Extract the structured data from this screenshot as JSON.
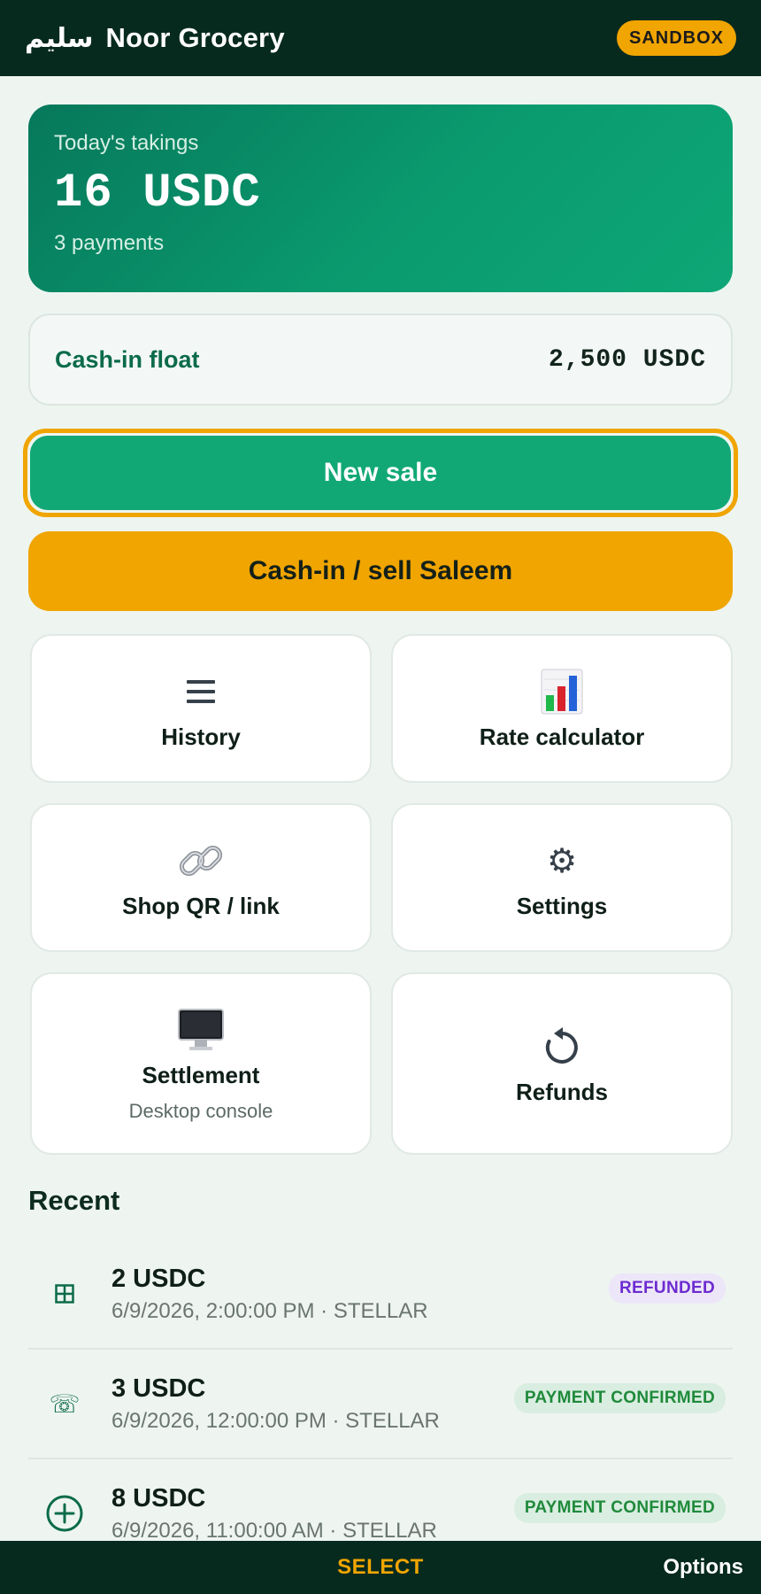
{
  "header": {
    "brand_arabic": "سليم",
    "brand_name": "Noor Grocery",
    "badge": "SANDBOX"
  },
  "takings": {
    "label": "Today's takings",
    "amount": "16 USDC",
    "count": "3 payments"
  },
  "float": {
    "label": "Cash-in float",
    "value": "2,500 USDC"
  },
  "actions": {
    "new_sale": "New sale",
    "cash_in": "Cash-in / sell Saleem"
  },
  "tiles": [
    {
      "label": "History",
      "icon": "list-icon"
    },
    {
      "label": "Rate calculator",
      "icon": "bar-chart-icon"
    },
    {
      "label": "Shop QR / link",
      "icon": "link-icon"
    },
    {
      "label": "Settings",
      "icon": "gear-icon"
    },
    {
      "label": "Settlement",
      "sub": "Desktop console",
      "icon": "desktop-icon"
    },
    {
      "label": "Refunds",
      "icon": "refresh-icon"
    }
  ],
  "recent": {
    "title": "Recent",
    "items": [
      {
        "amount": "2 USDC",
        "meta": "6/9/2026, 2:00:00 PM · STELLAR",
        "status": "REFUNDED",
        "icon": "grid-icon",
        "status_bg": "#ece6f8",
        "status_color": "#6d2bd1"
      },
      {
        "amount": "3 USDC",
        "meta": "6/9/2026, 12:00:00 PM · STELLAR",
        "status": "PAYMENT CONFIRMED",
        "icon": "phone-icon",
        "status_bg": "#d9ede1",
        "status_color": "#1f8a3a"
      },
      {
        "amount": "8 USDC",
        "meta": "6/9/2026, 11:00:00 AM · STELLAR",
        "status": "PAYMENT CONFIRMED",
        "icon": "plus-circle-icon",
        "status_bg": "#d9ede1",
        "status_color": "#1f8a3a"
      }
    ]
  },
  "softkeys": {
    "select": "SELECT",
    "options": "Options"
  }
}
